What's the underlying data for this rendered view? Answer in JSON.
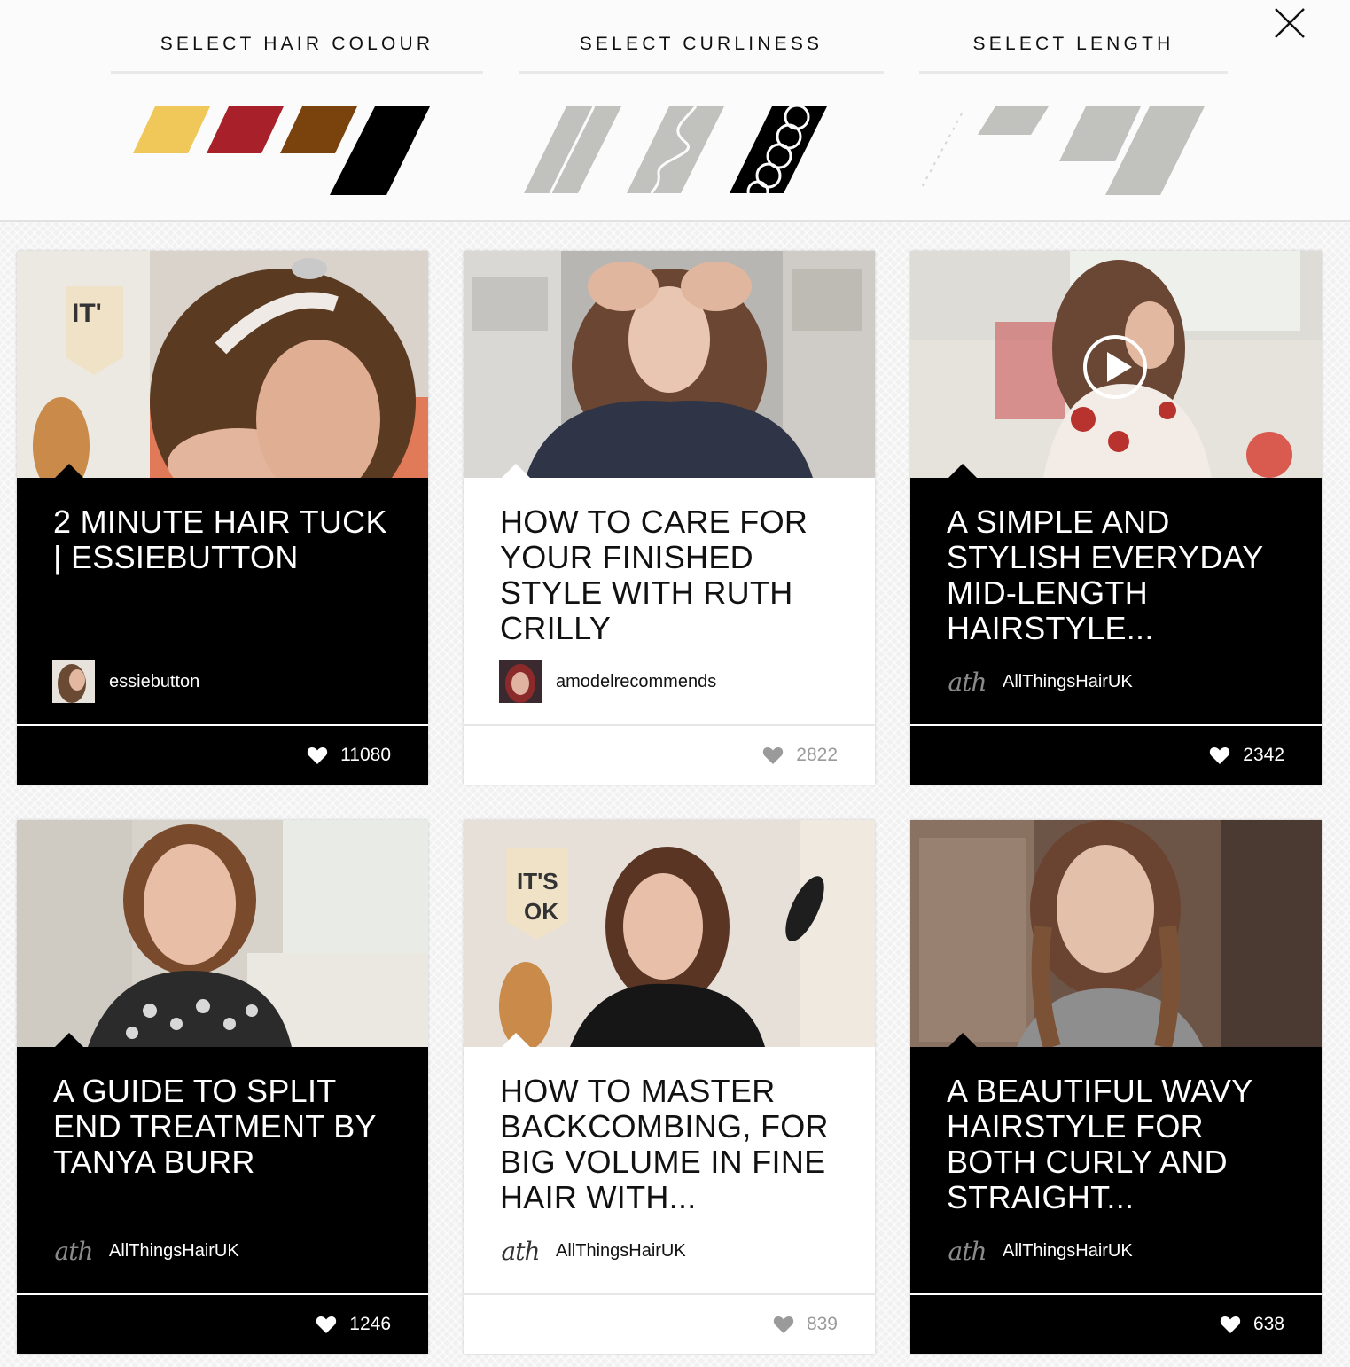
{
  "filters": {
    "hair_colour": {
      "title": "SELECT HAIR COLOUR",
      "swatches": [
        {
          "name": "blonde",
          "color": "#f0c85a",
          "selected": false
        },
        {
          "name": "red",
          "color": "#a8202a",
          "selected": false
        },
        {
          "name": "brown",
          "color": "#7a420c",
          "selected": false
        },
        {
          "name": "black",
          "color": "#000000",
          "selected": true
        }
      ]
    },
    "curliness": {
      "title": "SELECT CURLINESS",
      "options": [
        {
          "name": "straight",
          "selected": false
        },
        {
          "name": "wavy",
          "selected": false
        },
        {
          "name": "curly",
          "selected": true
        }
      ]
    },
    "length": {
      "title": "SELECT LENGTH",
      "options": [
        {
          "name": "short",
          "selected": false
        },
        {
          "name": "medium",
          "selected": false
        },
        {
          "name": "long",
          "selected": false
        }
      ]
    },
    "unselected_color": "#c1c1bd"
  },
  "close": {
    "icon": "close-icon"
  },
  "cards": [
    {
      "title": "2 MINUTE HAIR TUCK | ESSIEBUTTON",
      "author": "essiebutton",
      "author_type": "avatar",
      "likes": "11080",
      "theme": "dark"
    },
    {
      "title": "HOW TO CARE FOR YOUR FINISHED STYLE WITH RUTH CRILLY",
      "author": "amodelrecommends",
      "author_type": "avatar",
      "likes": "2822",
      "theme": "light"
    },
    {
      "title": "A SIMPLE AND STYLISH EVERYDAY MID-LENGTH HAIRSTYLE...",
      "author": "AllThingsHairUK",
      "author_type": "logo",
      "logo_text": "ath",
      "likes": "2342",
      "theme": "dark",
      "has_play": true
    },
    {
      "title": "A GUIDE TO SPLIT END TREATMENT BY TANYA BURR",
      "author": "AllThingsHairUK",
      "author_type": "logo",
      "logo_text": "ath",
      "likes": "1246",
      "theme": "dark"
    },
    {
      "title": "HOW TO MASTER BACKCOMBING, FOR BIG VOLUME IN FINE HAIR WITH...",
      "author": "AllThingsHairUK",
      "author_type": "logo",
      "logo_text": "ath",
      "likes": "839",
      "theme": "light"
    },
    {
      "title": "A BEAUTIFUL WAVY HAIRSTYLE FOR BOTH CURLY AND STRAIGHT...",
      "author": "AllThingsHairUK",
      "author_type": "logo",
      "logo_text": "ath",
      "likes": "638",
      "theme": "dark"
    }
  ]
}
